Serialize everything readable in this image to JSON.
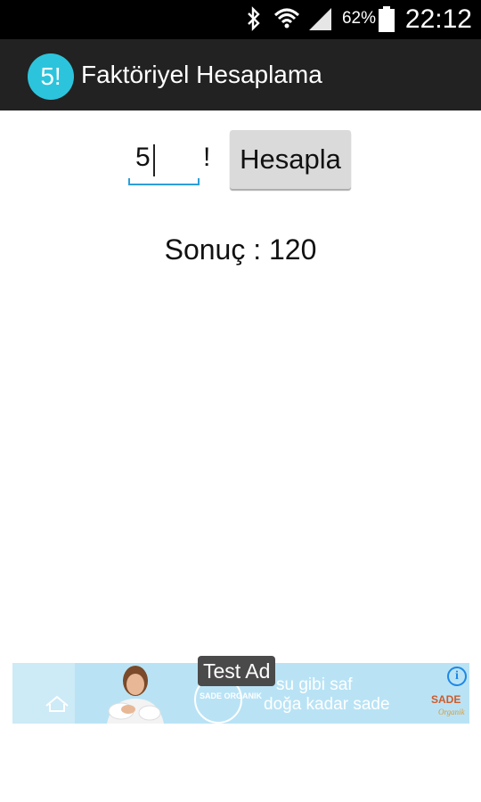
{
  "status_bar": {
    "time": "22:12",
    "battery_percent": "62%",
    "icons": [
      "bluetooth-icon",
      "wifi-icon",
      "signal-icon",
      "battery-icon"
    ]
  },
  "action_bar": {
    "app_icon_text": "5!",
    "title": "Faktöriyel Hesaplama",
    "app_icon_color": "#2cc4dc"
  },
  "calculator": {
    "input_value": "5",
    "factorial_symbol": "!",
    "button_label": "Hesapla",
    "result_label": "Sonuç :",
    "result_value": "120"
  },
  "ad": {
    "badge": "Test Ad",
    "line1": "su gibi saf",
    "line2": "doğa kadar sade",
    "circle_text": "SADE ORGANIK",
    "brand": "SADE",
    "info_icon": "info-icon"
  },
  "colors": {
    "status_bar": "#000000",
    "action_bar": "#222222",
    "accent_underline": "#2d9fd8",
    "ad_background": "#b9e3f5"
  }
}
